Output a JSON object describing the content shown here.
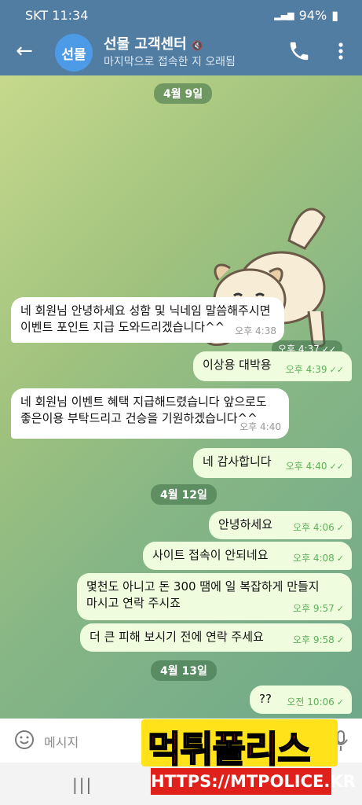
{
  "status": {
    "carrier": "SKT 11:34",
    "battery": "94%"
  },
  "header": {
    "back_icon": "arrow-left-icon",
    "avatar_text": "선물",
    "title": "선물 고객센터",
    "subtitle": "마지막으로 접속한 지 오래됨"
  },
  "dates": [
    "4월 9일",
    "4월 12일",
    "4월 13일"
  ],
  "sticker": {
    "time": "오후 4:37",
    "icon": "dog-sticker"
  },
  "messages": [
    {
      "dir": "in",
      "lines": [
        "네 회원님 안녕하세요 성함 및 닉네임 말씀해주시면",
        "이벤트 포인트 지급 도와드리겠습니다^^"
      ],
      "time": "오후 4:38"
    },
    {
      "dir": "out",
      "text": "이상용 대박용",
      "time": "오후 4:39",
      "check": "✓✓"
    },
    {
      "dir": "in",
      "lines": [
        "네 회원님 이벤트 혜택 지급해드렸습니다 앞으로도",
        "좋은이용 부탁드리고 건승을 기원하겠습니다^^"
      ],
      "time": "오후 4:40"
    },
    {
      "dir": "out",
      "text": "네 감사합니다",
      "time": "오후 4:40",
      "check": "✓✓"
    },
    {
      "dir": "out",
      "text": "안녕하세요",
      "time": "오후 4:06",
      "check": "✓"
    },
    {
      "dir": "out",
      "text": "사이트 접속이 안되네요",
      "time": "오후 4:08",
      "check": "✓"
    },
    {
      "dir": "out",
      "lines": [
        "몇천도 아니고 돈 300 땜에 일 복잡하게 만들지",
        "마시고 연락 주시죠"
      ],
      "time": "오후 9:57",
      "check": "✓"
    },
    {
      "dir": "out",
      "text": "더 큰 피해 보시기 전에 연락 주세요",
      "time": "오후 9:58",
      "check": "✓"
    },
    {
      "dir": "out",
      "text": "??",
      "time": "오전 10:06",
      "check": "✓"
    }
  ],
  "input": {
    "placeholder": "메시지",
    "emoji_icon": "smiley-icon",
    "mic_icon": "mic-icon"
  },
  "nav": {
    "recent": "|||"
  },
  "watermark": {
    "top": "먹튀폴리스",
    "bottom": "HTTPS://MTPOLICE.KR"
  },
  "colors": {
    "header": "#527da3",
    "out_bubble": "#effdde",
    "in_bubble": "#ffffff",
    "watermark_yellow": "#ffe21a",
    "watermark_red": "#e0201a"
  }
}
